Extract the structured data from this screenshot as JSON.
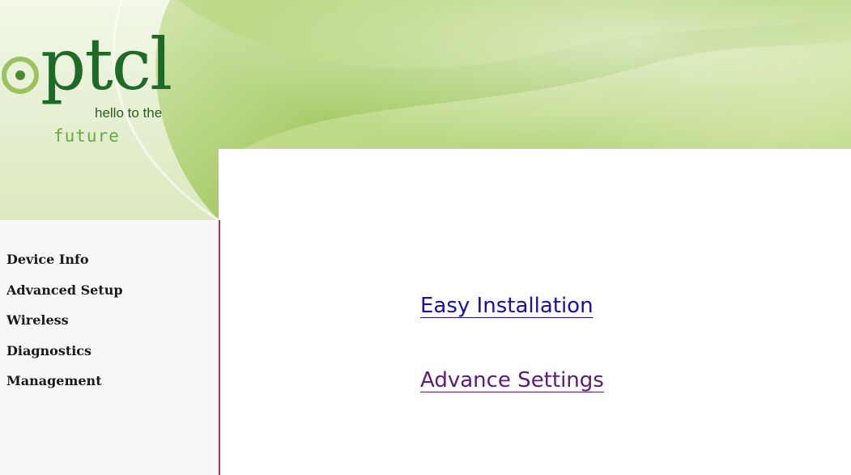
{
  "brand": {
    "logo_text": "ptcl",
    "tagline_line1": "hello to the",
    "tagline_line2": "future",
    "colors": {
      "banner_dark": "#8fbb4a",
      "banner_light": "#e6f0d0",
      "logo_green": "#1e6b28",
      "ring_green": "#9ac25e"
    }
  },
  "sidebar": {
    "items": [
      {
        "label": "Device Info"
      },
      {
        "label": "Advanced Setup"
      },
      {
        "label": "Wireless"
      },
      {
        "label": "Diagnostics"
      },
      {
        "label": "Management"
      }
    ],
    "border_color": "#b0324e"
  },
  "main": {
    "easy_install_label": "Easy Installation",
    "advance_settings_label": "Advance Settings",
    "link_color": "#1a0dab",
    "visited_link_color": "#5c1a7a"
  }
}
